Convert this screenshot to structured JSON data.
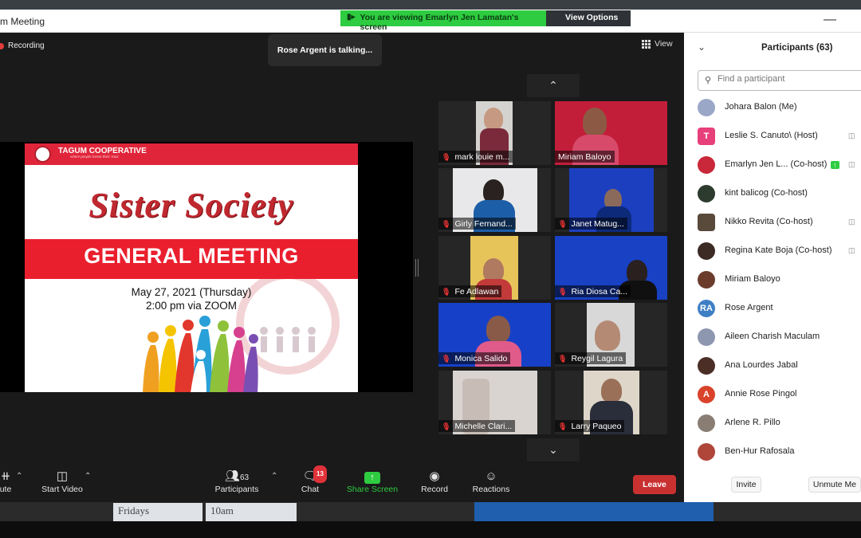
{
  "window": {
    "title": "m Meeting",
    "minimize": "—"
  },
  "banner": {
    "viewing": "You are viewing Emarlyn Jen Lamatan's screen",
    "view_options": "View Options ⌄"
  },
  "main": {
    "recording": "Recording",
    "talking": "Rose Argent is talking...",
    "view_label": "View"
  },
  "slide": {
    "org": "TAGUM COOPERATIVE",
    "tagline": "where people invest their trust",
    "title_script": "Sister Society",
    "title_band": "GENERAL MEETING",
    "date": "May 27, 2021 (Thursday)",
    "time": "2:00 pm via ZOOM"
  },
  "gallery": {
    "tiles": [
      {
        "name": "mark louie m..."
      },
      {
        "name": "Miriam Baloyo"
      },
      {
        "name": "Girly Fernand..."
      },
      {
        "name": "Janet Matug..."
      },
      {
        "name": "Fe Adlawan"
      },
      {
        "name": "Ria Diosa  Ca..."
      },
      {
        "name": "Monica Salido"
      },
      {
        "name": "Reygil Lagura"
      },
      {
        "name": "Michelle Clari..."
      },
      {
        "name": "Larry Paqueo"
      }
    ]
  },
  "toolbar": {
    "mute_label": "ute",
    "start_video": "Start Video",
    "participants_label": "Participants",
    "participants_count": "63",
    "chat_label": "Chat",
    "chat_badge": "13",
    "share_label": "Share Screen",
    "record_label": "Record",
    "reactions_label": "Reactions",
    "leave_label": "Leave"
  },
  "panel": {
    "title": "Participants (63)",
    "search_placeholder": "Find a participant",
    "invite": "Invite",
    "unmute_me": "Unmute Me",
    "participants": [
      {
        "name": "Johara Balon (Me)",
        "avatar": "",
        "color": "#9aa7c7"
      },
      {
        "name": "Leslie S. Canuto\\ (Host)",
        "avatar": "T",
        "color": "#e8407a"
      },
      {
        "name": "Emarlyn Jen L... (Co-host)",
        "avatar": "",
        "color": "#c9283a"
      },
      {
        "name": "kint balicog (Co-host)",
        "avatar": "",
        "color": "#2d3a2e"
      },
      {
        "name": "Nikko Revita (Co-host)",
        "avatar": "",
        "color": "#5a4a3c"
      },
      {
        "name": "Regina Kate Boja (Co-host)",
        "avatar": "",
        "color": "#3c2a24"
      },
      {
        "name": "Miriam Baloyo",
        "avatar": "",
        "color": "#6b3c2c"
      },
      {
        "name": "Rose Argent",
        "avatar": "RA",
        "color": "#3f7fc4"
      },
      {
        "name": "Aileen Charish Maculam",
        "avatar": "",
        "color": "#8e97b0"
      },
      {
        "name": "Ana Lourdes Jabal",
        "avatar": "",
        "color": "#4b2e25"
      },
      {
        "name": "Annie Rose Pingol",
        "avatar": "A",
        "color": "#d9432b"
      },
      {
        "name": "Arlene R. Pillo",
        "avatar": "",
        "color": "#8a7e74"
      },
      {
        "name": "Ben-Hur Rafosala",
        "avatar": "",
        "color": "#b0453a"
      }
    ]
  },
  "desktop": {
    "cell1": "Fridays",
    "cell2": "10am"
  }
}
